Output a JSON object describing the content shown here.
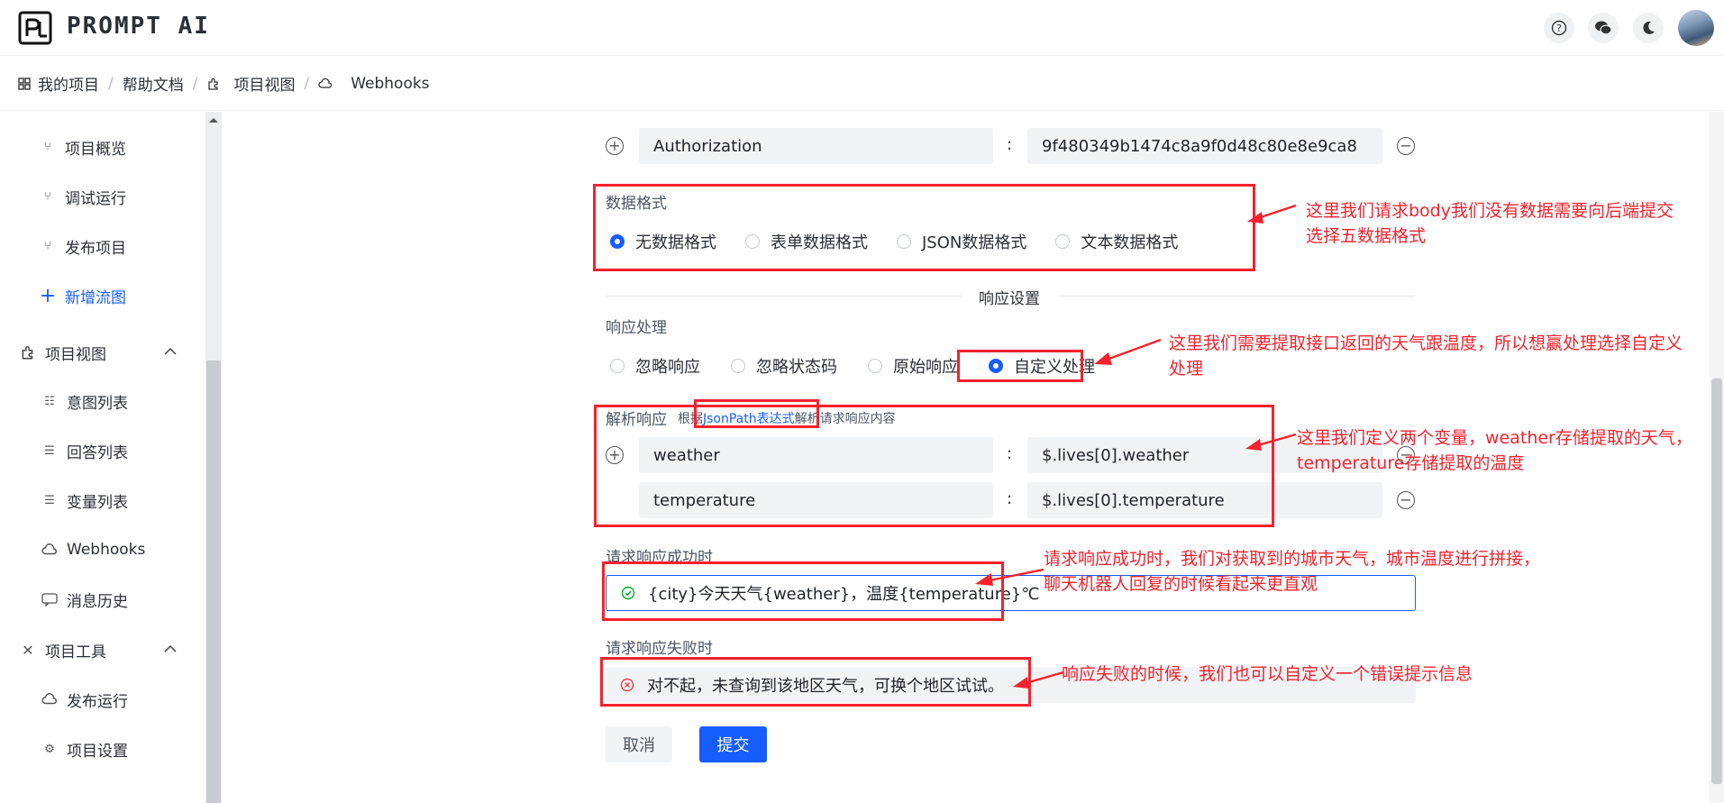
{
  "app": {
    "brand": "PROMPT AI"
  },
  "breadcrumb": {
    "items": [
      {
        "label": "我的项目",
        "icon": "grid-icon"
      },
      {
        "label": "帮助文档",
        "icon": ""
      },
      {
        "label": "项目视图",
        "icon": "puzzle-icon"
      },
      {
        "label": "Webhooks",
        "icon": "cloud-icon"
      }
    ]
  },
  "sidebar": {
    "items": [
      {
        "label": "项目概览",
        "icon": "branch-icon",
        "type": "sub"
      },
      {
        "label": "调试运行",
        "icon": "branch-icon",
        "type": "sub"
      },
      {
        "label": "发布项目",
        "icon": "branch-icon",
        "type": "sub"
      },
      {
        "label": "新增流图",
        "icon": "plus-icon",
        "type": "sub-accent"
      },
      {
        "label": "项目视图",
        "icon": "puzzle-icon",
        "type": "group"
      },
      {
        "label": "意图列表",
        "icon": "list-icon",
        "type": "sub"
      },
      {
        "label": "回答列表",
        "icon": "list-check-icon",
        "type": "sub"
      },
      {
        "label": "变量列表",
        "icon": "list-icon",
        "type": "sub"
      },
      {
        "label": "Webhooks",
        "icon": "cloud-icon",
        "type": "sub"
      },
      {
        "label": "消息历史",
        "icon": "chat-icon",
        "type": "sub"
      },
      {
        "label": "项目工具",
        "icon": "tools-icon",
        "type": "group"
      },
      {
        "label": "发布运行",
        "icon": "cloud-upload-icon",
        "type": "sub"
      },
      {
        "label": "项目设置",
        "icon": "gear-icon",
        "type": "sub"
      }
    ]
  },
  "form": {
    "header": {
      "key": "Authorization",
      "value": "9f480349b1474c8a9f0d48c80e8e9ca8"
    },
    "data_format": {
      "label": "数据格式",
      "options": [
        "无数据格式",
        "表单数据格式",
        "JSON数据格式",
        "文本数据格式"
      ],
      "selected": 0
    },
    "response_settings_title": "响应设置",
    "response_handling": {
      "label": "响应处理",
      "options": [
        "忽略响应",
        "忽略状态码",
        "原始响应",
        "自定义处理"
      ],
      "selected": 3
    },
    "parse_response": {
      "label": "解析响应",
      "hint_prefix": "根据",
      "hint_link": "JsonPath表达式",
      "hint_suffix": "解析请求响应内容",
      "rows": [
        {
          "key": "weather",
          "value": "$.lives[0].weather"
        },
        {
          "key": "temperature",
          "value": "$.lives[0].temperature"
        }
      ]
    },
    "success": {
      "label": "请求响应成功时",
      "value": "{city}今天天气{weather}，温度{temperature}℃"
    },
    "failure": {
      "label": "请求响应失败时",
      "value": "对不起，未查询到该地区天气，可换个地区试试。"
    },
    "cancel_label": "取消",
    "submit_label": "提交"
  },
  "annotations": {
    "a1_line1": "这里我们请求body我们没有数据需要向后端提交",
    "a1_line2": "选择五数据格式",
    "a2_line1": "这里我们需要提取接口返回的天气跟温度，所以想赢处理选择自定义",
    "a2_line2": "处理",
    "a3_line1": "这里我们定义两个变量，weather存储提取的天气，",
    "a3_line2": "temperature存储提取的温度",
    "a4_line1": "请求响应成功时，我们对获取到的城市天气，城市温度进行拼接，",
    "a4_line2": "聊天机器人回复的时候看起来更直观",
    "a5_line1": "响应失败的时候，我们也可以自定义一个错误提示信息"
  },
  "colors": {
    "accent": "#165dff",
    "annotation": "#f5222d",
    "success": "#00b42a",
    "error": "#f53f3f"
  }
}
